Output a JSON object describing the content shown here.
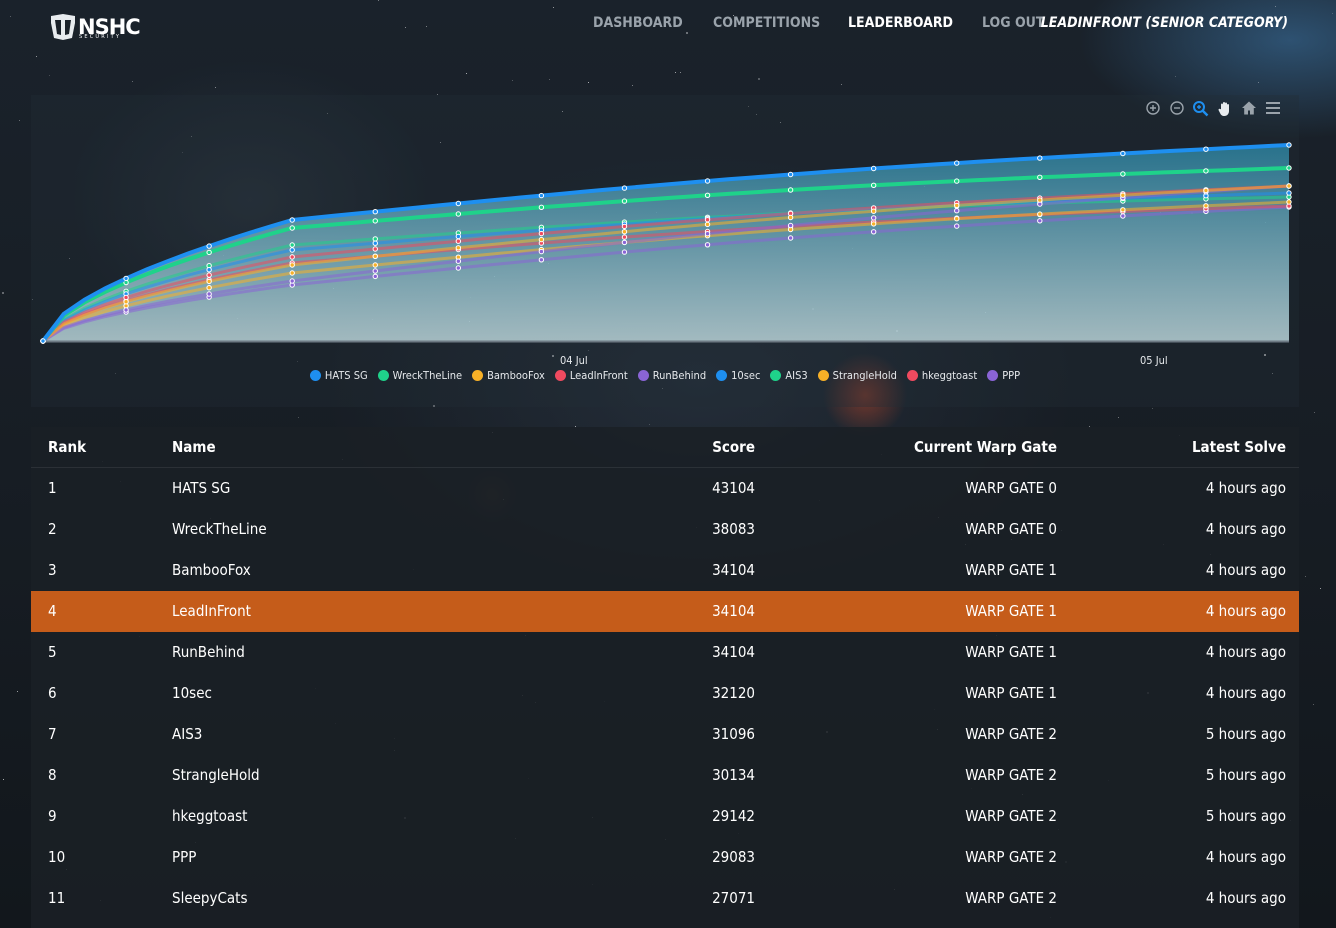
{
  "nav": {
    "logo_text": "NSHC",
    "logo_subtext": "SECURITY",
    "links": [
      "DASHBOARD",
      "COMPETITIONS",
      "LEADERBOARD",
      "LOG OUT"
    ],
    "active": "LEADERBOARD",
    "user": "LEADINFRONT (SENIOR CATEGORY)"
  },
  "chart_toolbar": [
    "zoom-in-icon",
    "zoom-out-icon",
    "selection-zoom-icon",
    "pan-hand-icon",
    "reset-home-icon",
    "menu-icon"
  ],
  "chart_data": {
    "type": "line",
    "x_tick_labels": [
      "04 Jul",
      "05 Jul"
    ],
    "series": [
      {
        "name": "HATS SG",
        "color": "#1e8ff0"
      },
      {
        "name": "WreckTheLine",
        "color": "#1fd28a"
      },
      {
        "name": "BambooFox",
        "color": "#f7b027"
      },
      {
        "name": "LeadInFront",
        "color": "#ef4a5f"
      },
      {
        "name": "RunBehind",
        "color": "#8a64d6"
      },
      {
        "name": "10sec",
        "color": "#1e8ff0"
      },
      {
        "name": "AIS3",
        "color": "#1fd28a"
      },
      {
        "name": "StrangleHold",
        "color": "#f7b027"
      },
      {
        "name": "hkeggtoast",
        "color": "#ef4a5f"
      },
      {
        "name": "PPP",
        "color": "#8a64d6"
      }
    ],
    "legend_position": "bottom-center",
    "grid": false
  },
  "table": {
    "headers": {
      "rank": "Rank",
      "name": "Name",
      "score": "Score",
      "gate": "Current Warp Gate",
      "time": "Latest Solve"
    },
    "rows": [
      {
        "rank": "1",
        "name": "HATS SG",
        "score": "43104",
        "gate": "WARP GATE 0",
        "time": "4 hours ago"
      },
      {
        "rank": "2",
        "name": "WreckTheLine",
        "score": "38083",
        "gate": "WARP GATE 0",
        "time": "4 hours ago"
      },
      {
        "rank": "3",
        "name": "BambooFox",
        "score": "34104",
        "gate": "WARP GATE 1",
        "time": "4 hours ago"
      },
      {
        "rank": "4",
        "name": "LeadInFront",
        "score": "34104",
        "gate": "WARP GATE 1",
        "time": "4 hours ago"
      },
      {
        "rank": "5",
        "name": "RunBehind",
        "score": "34104",
        "gate": "WARP GATE 1",
        "time": "4 hours ago"
      },
      {
        "rank": "6",
        "name": "10sec",
        "score": "32120",
        "gate": "WARP GATE 1",
        "time": "4 hours ago"
      },
      {
        "rank": "7",
        "name": "AIS3",
        "score": "31096",
        "gate": "WARP GATE 2",
        "time": "5 hours ago"
      },
      {
        "rank": "8",
        "name": "StrangleHold",
        "score": "30134",
        "gate": "WARP GATE 2",
        "time": "5 hours ago"
      },
      {
        "rank": "9",
        "name": "hkeggtoast",
        "score": "29142",
        "gate": "WARP GATE 2",
        "time": "5 hours ago"
      },
      {
        "rank": "10",
        "name": "PPP",
        "score": "29083",
        "gate": "WARP GATE 2",
        "time": "4 hours ago"
      },
      {
        "rank": "11",
        "name": "SleepyCats",
        "score": "27071",
        "gate": "WARP GATE 2",
        "time": "4 hours ago"
      }
    ],
    "highlight_rank": "4",
    "highlight_color": "#c55c1a"
  }
}
